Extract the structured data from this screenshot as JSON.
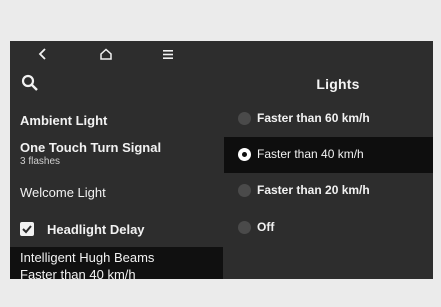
{
  "header": {
    "title": "Lights"
  },
  "nav": {
    "back_icon": "chevron-left-icon",
    "home_icon": "home-icon",
    "menu_icon": "menu-icon",
    "search_icon": "search-icon"
  },
  "left_menu": {
    "items": [
      {
        "label": "Ambient Light"
      },
      {
        "label": "One Touch Turn Signal",
        "sub": "3 flashes"
      },
      {
        "label": "Welcome Light"
      },
      {
        "label": "Headlight Delay",
        "checked": true
      },
      {
        "label": "Intelligent Hugh Beams",
        "sub": "Faster than 40 km/h",
        "selected": true
      }
    ]
  },
  "options": {
    "items": [
      {
        "label": "Faster than 60 km/h",
        "selected": false
      },
      {
        "label": "Faster than 40 km/h",
        "selected": true
      },
      {
        "label": "Faster than 20 km/h",
        "selected": false
      },
      {
        "label": "Off",
        "selected": false
      }
    ]
  },
  "colors": {
    "background": "#2d2d2d",
    "selected_row": "#0e0e0e",
    "text": "#f2f2f2"
  }
}
